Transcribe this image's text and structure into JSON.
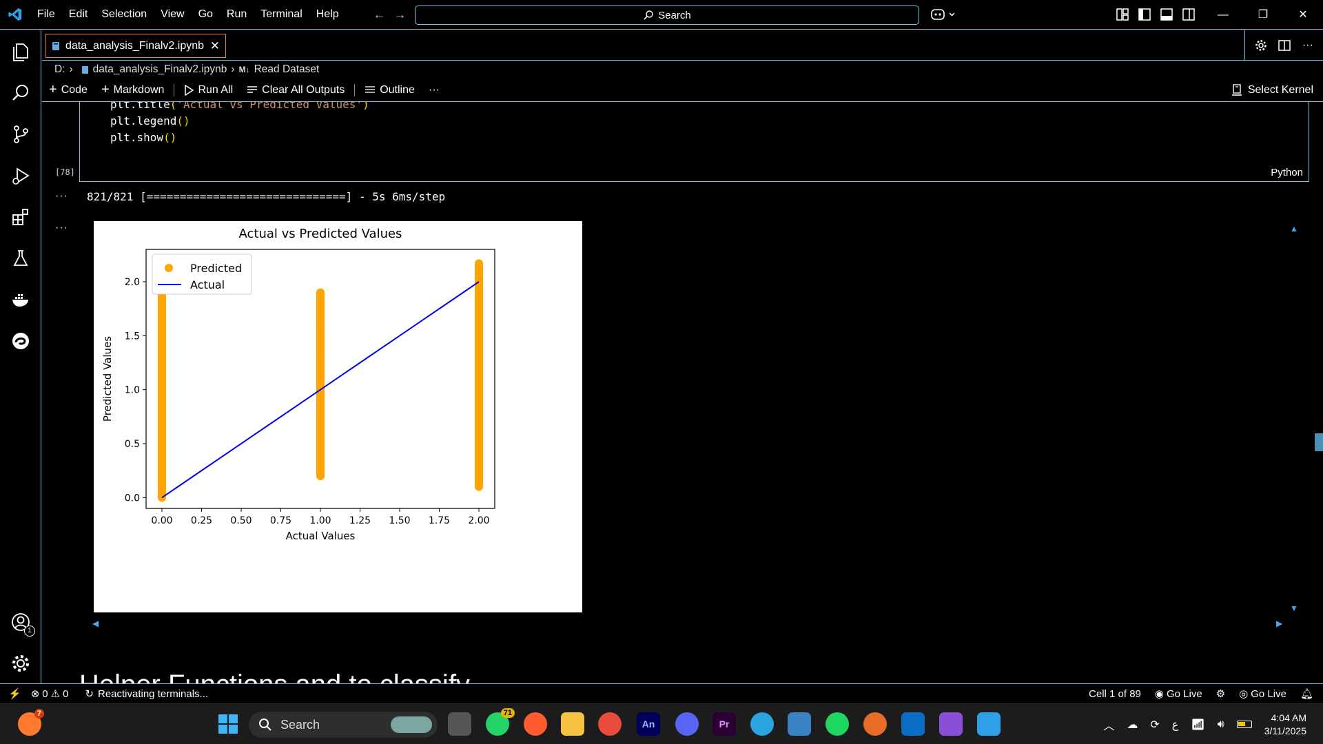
{
  "titlebar": {
    "menu": [
      "File",
      "Edit",
      "Selection",
      "View",
      "Go",
      "Run",
      "Terminal",
      "Help"
    ],
    "search_label": "Search"
  },
  "tab": {
    "filename": "data_analysis_Finalv2.ipynb",
    "close_icon": "close-icon"
  },
  "breadcrumb": {
    "drive": "D:",
    "file": "data_analysis_Finalv2.ipynb",
    "md_badge": "M↓",
    "section": "Read Dataset"
  },
  "toolbar": {
    "code": "Code",
    "markdown": "Markdown",
    "run_all": "Run All",
    "clear_outputs": "Clear All Outputs",
    "outline": "Outline",
    "more": "···",
    "select_kernel": "Select Kernel"
  },
  "cell": {
    "code_lines": [
      {
        "pre": "plt.title",
        "open": "(",
        "str": "'Actual vs Predicted Values'",
        "close": ")"
      },
      {
        "pre": "plt.legend",
        "open": "(",
        "str": "",
        "close": ")"
      },
      {
        "pre": "plt.show",
        "open": "(",
        "str": "",
        "close": ")"
      }
    ],
    "exec_count": "[78]",
    "language": "Python"
  },
  "output": {
    "dots": "···",
    "progress": "821/821 [==============================] - 5s 6ms/step"
  },
  "chart_data": {
    "type": "scatter",
    "title": "Actual vs Predicted Values",
    "xlabel": "Actual Values",
    "ylabel": "Predicted Values",
    "xlim": [
      -0.1,
      2.1
    ],
    "ylim": [
      -0.1,
      2.3
    ],
    "xticks": [
      "0.00",
      "0.25",
      "0.50",
      "0.75",
      "1.00",
      "1.25",
      "1.50",
      "1.75",
      "2.00"
    ],
    "yticks": [
      "0.0",
      "0.5",
      "1.0",
      "1.5",
      "2.0"
    ],
    "legend_position": "top-left",
    "series": [
      {
        "name": "Predicted",
        "kind": "scatter",
        "color": "#ffa500",
        "groups": [
          {
            "x": 0.0,
            "y_min": 0.0,
            "y_max": 1.88
          },
          {
            "x": 1.0,
            "y_min": 0.2,
            "y_max": 1.9
          },
          {
            "x": 2.0,
            "y_min": 0.1,
            "y_max": 2.17
          }
        ]
      },
      {
        "name": "Actual",
        "kind": "line",
        "color": "#0000ee",
        "x": [
          0.0,
          1.0,
          2.0
        ],
        "y": [
          0.0,
          1.0,
          2.0
        ]
      }
    ]
  },
  "next_cell_heading": "Helper Functions and to classify",
  "statusbar": {
    "errors": "0",
    "warnings": "0",
    "activity": "Reactivating terminals...",
    "cell_position": "Cell 1 of 89",
    "go_live_1": "Go Live",
    "go_live_2": "Go Live"
  },
  "taskbar": {
    "search_label": "Search",
    "notif_count": "7",
    "whatsapp_badge": "71",
    "an_label": "An",
    "pr_label": "Pr",
    "time": "4:04 AM",
    "date": "3/11/2025",
    "ime": "ع"
  },
  "accounts_badge": "1",
  "colors": {
    "accent_border": "#6fc3df",
    "active_tab_border": "#f38518",
    "predicted": "#ffa500",
    "actual": "#0000ee"
  }
}
